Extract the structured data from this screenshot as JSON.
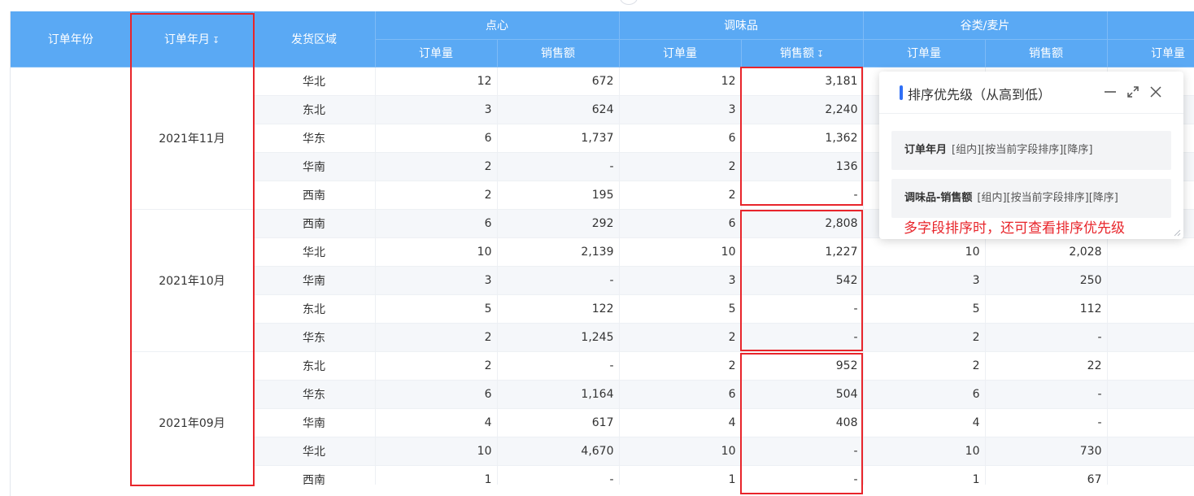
{
  "table": {
    "header_top": {
      "year": "订单年份",
      "month": "订单年月",
      "region": "发货区域",
      "categories": [
        "点心",
        "调味品",
        "谷类/麦片"
      ]
    },
    "sub_headers": [
      "订单量",
      "销售额",
      "订单量",
      "销售额",
      "订单量",
      "销售额",
      "订单量"
    ],
    "groups": [
      {
        "month": "2021年11月",
        "rows": [
          {
            "region": "华北",
            "vals": [
              "12",
              "672",
              "12",
              "3,181",
              "",
              "",
              ""
            ]
          },
          {
            "region": "东北",
            "vals": [
              "3",
              "624",
              "3",
              "2,240",
              "",
              "",
              ""
            ]
          },
          {
            "region": "华东",
            "vals": [
              "6",
              "1,737",
              "6",
              "1,362",
              "",
              "",
              ""
            ]
          },
          {
            "region": "华南",
            "vals": [
              "2",
              "-",
              "2",
              "136",
              "",
              "",
              ""
            ]
          },
          {
            "region": "西南",
            "vals": [
              "2",
              "195",
              "2",
              "-",
              "",
              "",
              ""
            ]
          }
        ]
      },
      {
        "month": "2021年10月",
        "rows": [
          {
            "region": "西南",
            "vals": [
              "6",
              "292",
              "6",
              "2,808",
              "",
              "",
              ""
            ]
          },
          {
            "region": "华北",
            "vals": [
              "10",
              "2,139",
              "10",
              "1,227",
              "10",
              "2,028",
              ""
            ]
          },
          {
            "region": "华南",
            "vals": [
              "3",
              "-",
              "3",
              "542",
              "3",
              "250",
              ""
            ]
          },
          {
            "region": "东北",
            "vals": [
              "5",
              "122",
              "5",
              "-",
              "5",
              "112",
              ""
            ]
          },
          {
            "region": "华东",
            "vals": [
              "2",
              "1,245",
              "2",
              "-",
              "2",
              "-",
              ""
            ]
          }
        ]
      },
      {
        "month": "2021年09月",
        "rows": [
          {
            "region": "东北",
            "vals": [
              "2",
              "-",
              "2",
              "952",
              "2",
              "22",
              ""
            ]
          },
          {
            "region": "华东",
            "vals": [
              "6",
              "1,164",
              "6",
              "504",
              "6",
              "-",
              ""
            ]
          },
          {
            "region": "华南",
            "vals": [
              "4",
              "617",
              "4",
              "408",
              "4",
              "-",
              ""
            ]
          },
          {
            "region": "华北",
            "vals": [
              "10",
              "4,670",
              "10",
              "-",
              "10",
              "730",
              ""
            ]
          },
          {
            "region": "西南",
            "vals": [
              "1",
              "-",
              "1",
              "-",
              "1",
              "67",
              ""
            ]
          }
        ]
      }
    ]
  },
  "panel": {
    "title": "排序优先级（从高到低）",
    "rules": [
      {
        "field": "订单年月",
        "desc": "[组内][按当前字段排序][降序]"
      },
      {
        "field": "调味品-销售额",
        "desc": "[组内][按当前字段排序][降序]"
      }
    ],
    "annotation": "多字段排序时，还可查看排序优先级"
  },
  "colors": {
    "header_bg": "#5aa9f4",
    "highlight": "#e8252b",
    "panel_accent": "#2f6ff6"
  },
  "icons": [
    "sort-desc-icon",
    "minimize-icon",
    "expand-icon",
    "close-icon",
    "resize-grip-icon"
  ]
}
